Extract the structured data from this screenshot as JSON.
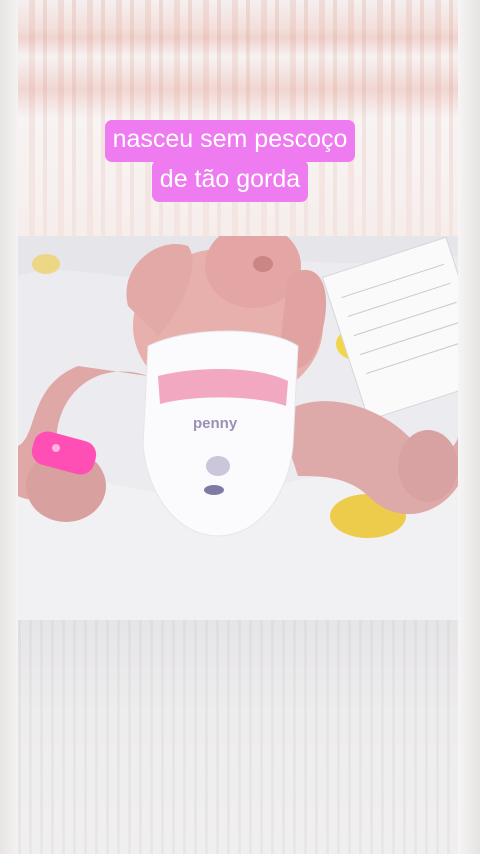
{
  "caption": {
    "line1": "nasceu sem pescoço",
    "line2": "de tão gorda"
  },
  "photo": {
    "diaper_brand_text": "penny"
  },
  "colors": {
    "caption_bg": "#ee7cf0",
    "caption_text": "#ffffff",
    "wristband": "#ff4fb4"
  }
}
